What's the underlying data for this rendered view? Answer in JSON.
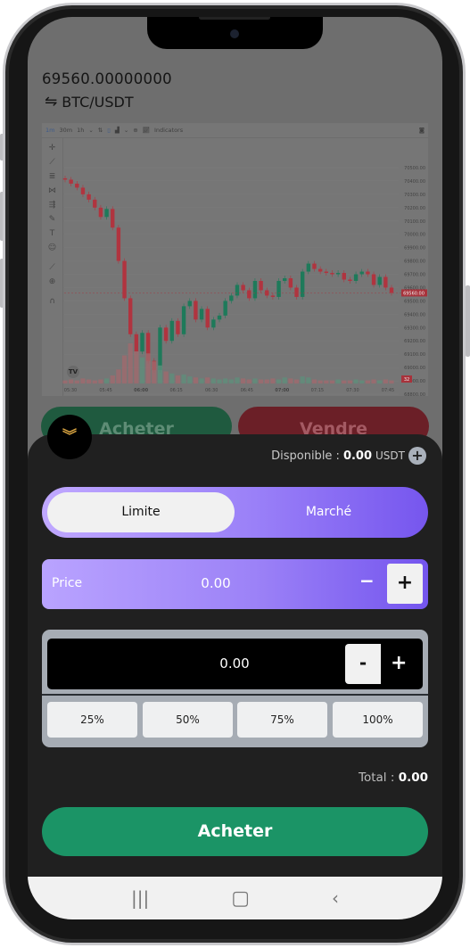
{
  "header": {
    "last_price": "69560.00000000",
    "pair": "BTC/USDT",
    "swap_icon": "swap-arrows-icon"
  },
  "chart_toolbar": {
    "intervals": [
      "1m",
      "30m",
      "1h"
    ],
    "active_interval": "1m",
    "indicators_label": "Indicators"
  },
  "chart_data": {
    "type": "candlestick",
    "price_ticks": [
      "70500.00",
      "70400.00",
      "70300.00",
      "70200.00",
      "70100.00",
      "70000.00",
      "69900.00",
      "69800.00",
      "69700.00",
      "69600.00",
      "69500.00",
      "69400.00",
      "69300.00",
      "69200.00",
      "69100.00",
      "69000.00",
      "68900.00",
      "68800.00"
    ],
    "time_ticks": [
      "05:30",
      "05:45",
      "06:00",
      "06:15",
      "06:30",
      "06:45",
      "07:00",
      "07:15",
      "07:30",
      "07:45"
    ],
    "ylim": [
      68800,
      70500
    ],
    "open": 70420,
    "closes": [
      70410,
      70380,
      70350,
      70300,
      70260,
      70200,
      70130,
      70190,
      70050,
      69800,
      69520,
      69250,
      69120,
      69260,
      69050,
      68980,
      69300,
      69200,
      69350,
      69250,
      69460,
      69500,
      69360,
      69440,
      69300,
      69360,
      69390,
      69500,
      69540,
      69620,
      69580,
      69520,
      69650,
      69580,
      69540,
      69530,
      69650,
      69670,
      69600,
      69530,
      69720,
      69780,
      69740,
      69720,
      69710,
      69700,
      69710,
      69660,
      69650,
      69700,
      69720,
      69700,
      69620,
      69680,
      69600,
      69560
    ],
    "volumes": [
      3,
      4,
      3,
      5,
      4,
      3,
      4,
      5,
      8,
      14,
      28,
      40,
      32,
      26,
      30,
      22,
      18,
      12,
      10,
      8,
      9,
      7,
      6,
      5,
      6,
      5,
      4,
      5,
      4,
      6,
      5,
      4,
      5,
      4,
      4,
      5,
      4,
      6,
      5,
      4,
      7,
      6,
      4,
      3,
      3,
      3,
      4,
      3,
      3,
      4,
      3,
      3,
      4,
      3,
      4,
      3
    ],
    "last_price_label": "69560.00",
    "volume_label": "32",
    "up_color": "#1e7a5a",
    "down_color": "#b0343f"
  },
  "side_buttons": {
    "buy": "Acheter",
    "sell": "Vendre"
  },
  "order": {
    "available_label": "Disponible :",
    "available_value": "0.00",
    "available_unit": "USDT",
    "tabs": [
      "Limite",
      "Marché"
    ],
    "active_tab": "Limite",
    "price_label": "Price",
    "price_value": "0.00",
    "minus": "−",
    "plus": "+",
    "amount_value": "0.00",
    "amount_minus": "-",
    "amount_plus": "+",
    "percents": [
      "25%",
      "50%",
      "75%",
      "100%"
    ],
    "total_label": "Total  :",
    "total_value": "0.00",
    "submit": "Acheter"
  },
  "colors": {
    "accent_purple": "#8a6cf4",
    "buy_green": "#1b9466",
    "sell_red": "#b0343f"
  }
}
